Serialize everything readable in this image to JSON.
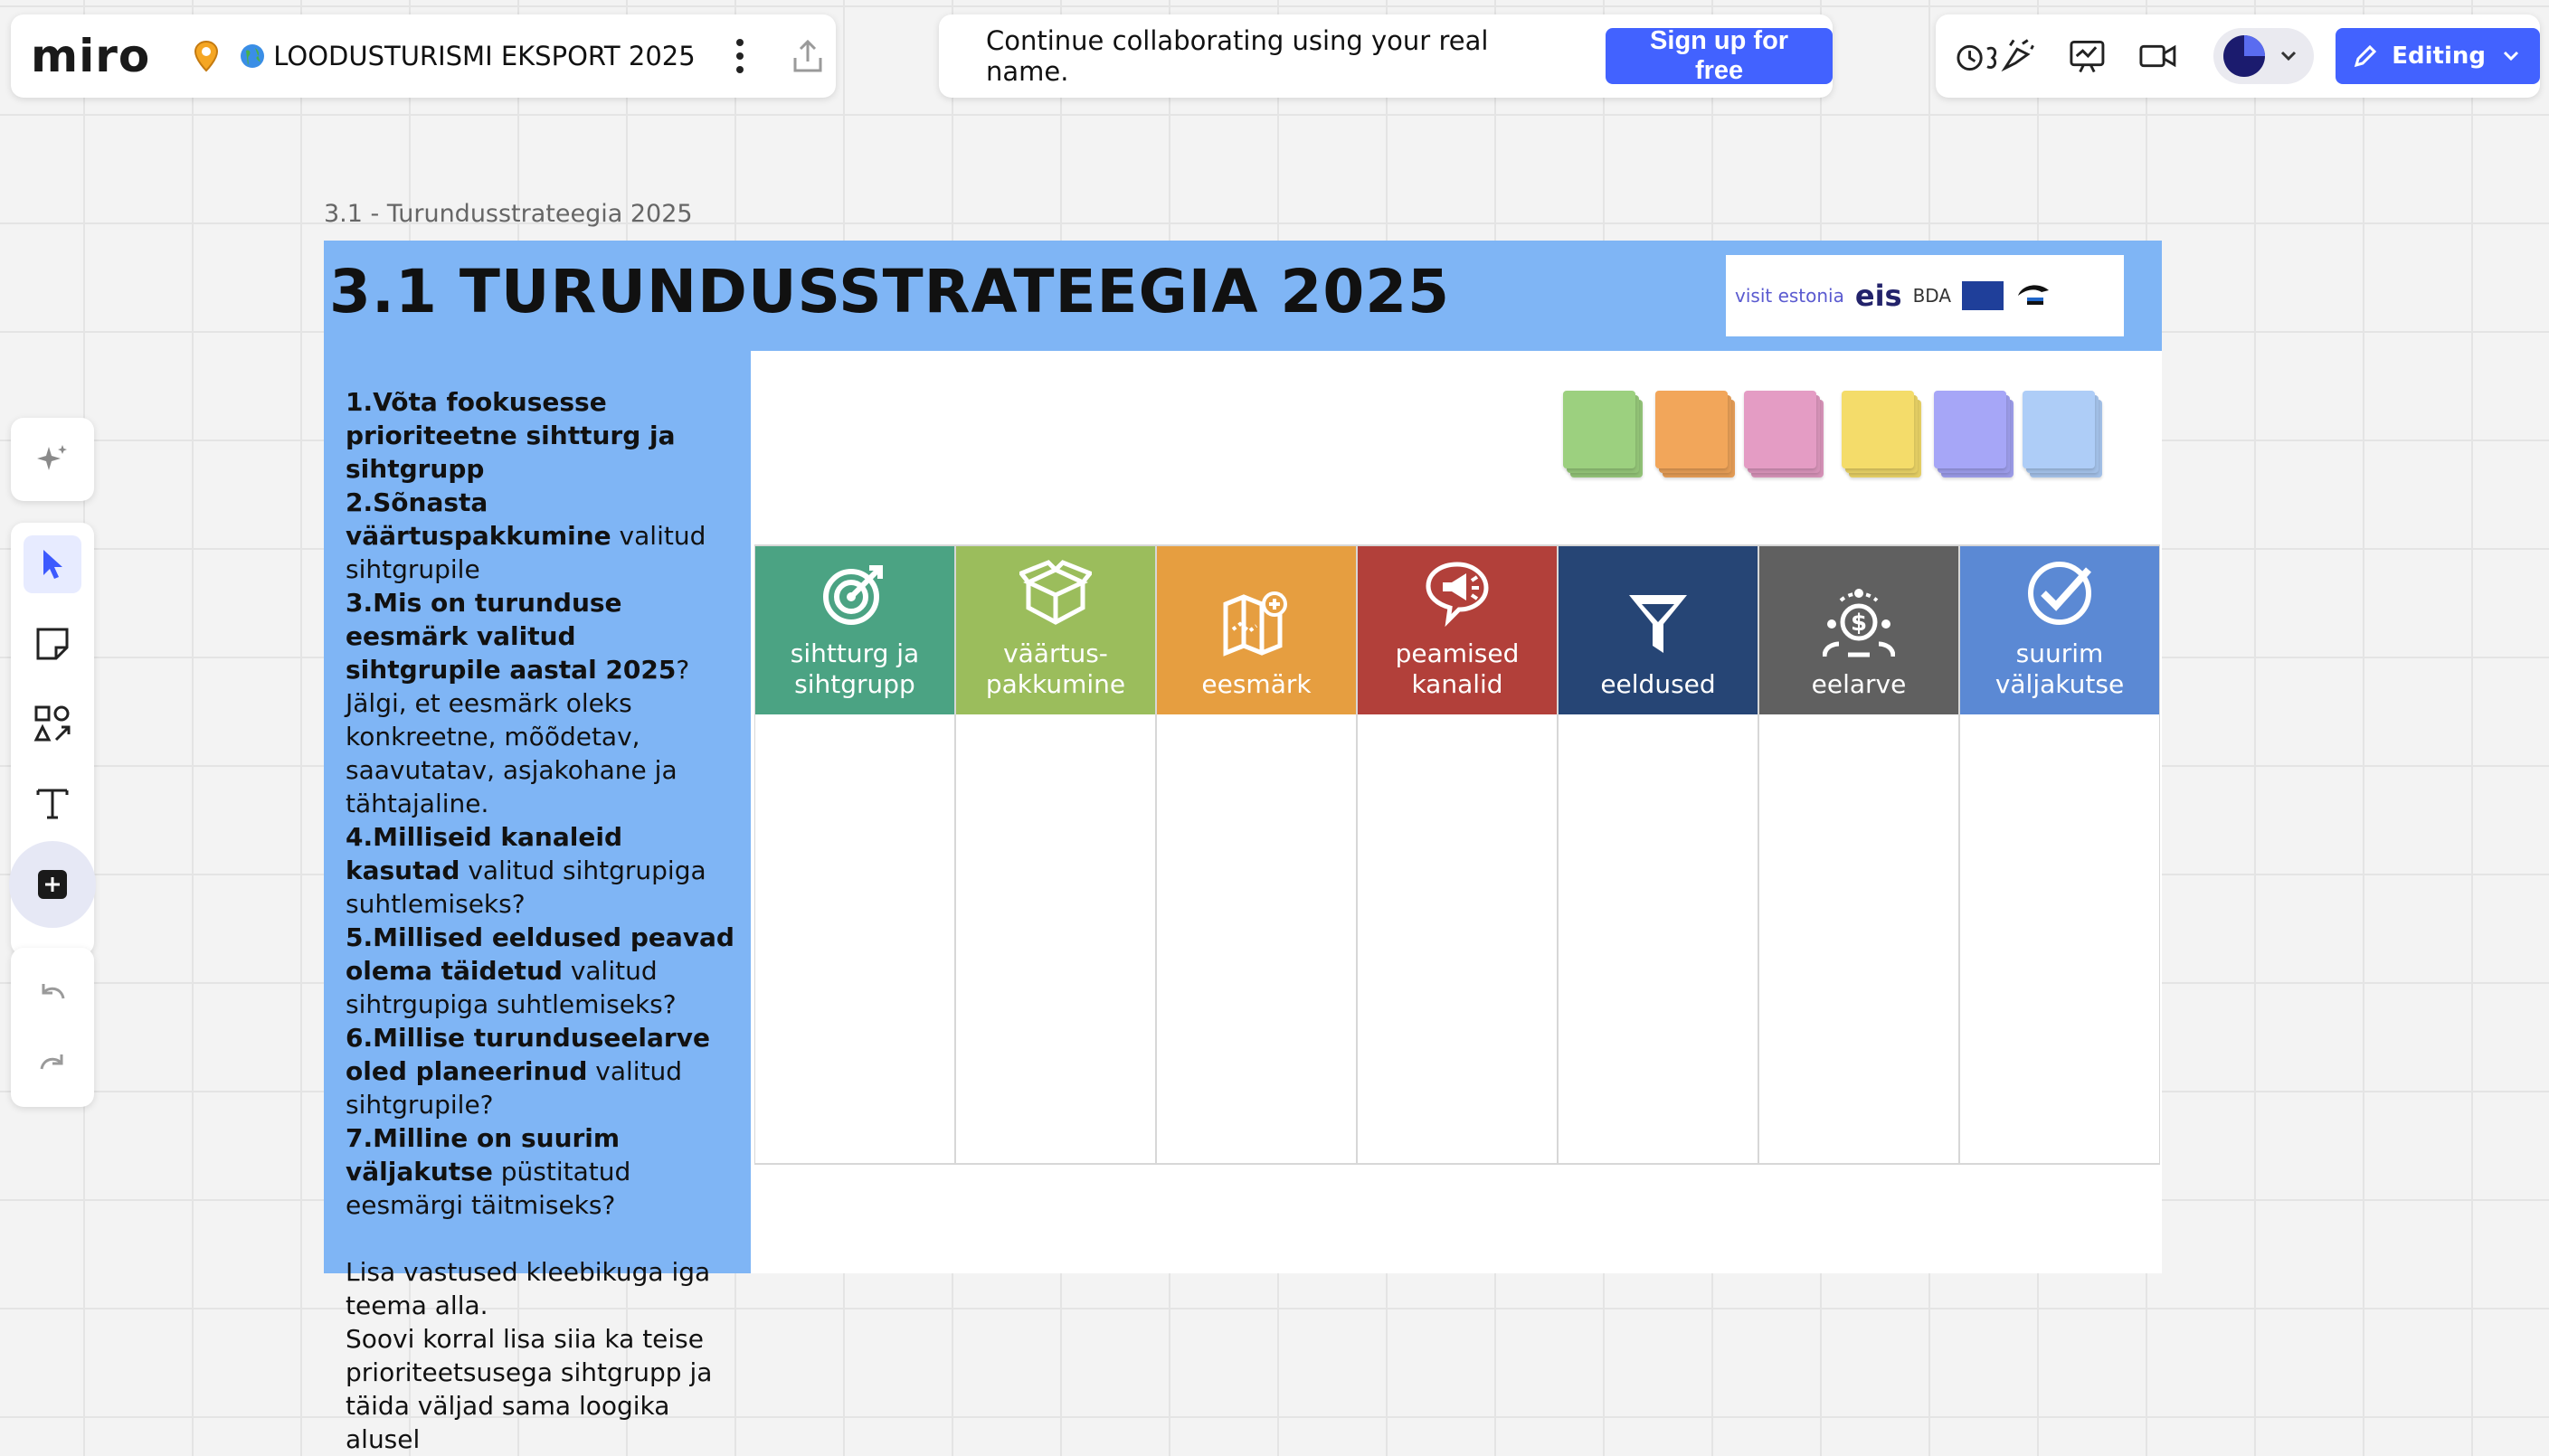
{
  "app": {
    "logo": "miro",
    "board_title": "LOODUSTURISMI EKSPORT 2025"
  },
  "banner": {
    "text": "Continue collaborating using your real name.",
    "signup_label": "Sign up for free"
  },
  "top_right": {
    "editing_label": "Editing"
  },
  "frame": {
    "label": "3.1 - Turundusstrateegia 2025",
    "title": "3.1 TURUNDUSSTRATEEGIA 2025",
    "logos": {
      "visit": "visit estonia",
      "eis": "eis",
      "bda": "BDA"
    }
  },
  "instructions": {
    "q1_bold": "1.Võta fookusesse prioriteetne sihtturg ja sihtgrupp",
    "q2_bold": "2.Sõnasta väärtuspakkumine",
    "q2_rest": " valitud sihtgrupile",
    "q3_bold": "3.Mis on turunduse eesmärk valitud sihtgrupile aastal 2025",
    "q3_rest": "?",
    "q3_note": "Jälgi, et eesmärk oleks konkreetne, mõõdetav, saavutatav, asjakohane ja tähtajaline.",
    "q4_bold": "4.Milliseid kanaleid kasutad",
    "q4_rest": " valitud sihtgrupiga suhtlemiseks?",
    "q5_bold": "5.Millised eeldused peavad olema täidetud",
    "q5_rest": " valitud sihtrgupiga suhtlemiseks?",
    "q6_bold": "6.Millise turunduseelarve oled planeerinud",
    "q6_rest": " valitud sihtgrupile?",
    "q7_bold": "7.Milline on suurim väljakutse",
    "q7_rest": " püstitatud eesmärgi täitmiseks?",
    "footer1": "Lisa vastused kleebikuga iga teema alla.",
    "footer2": "Soovi korral lisa siia ka teise prioriteetsusega sihtgrupp ja täida väljad sama loogika alusel"
  },
  "sticky_colors": [
    "#9cd07f",
    "#f2a65a",
    "#e49cc4",
    "#f4dc6a",
    "#a6a6f7",
    "#aecdf7"
  ],
  "columns": [
    {
      "l1": "sihtturg ja",
      "l2": "sihtgrupp",
      "color": "#4ba383",
      "icon": "target-icon"
    },
    {
      "l1": "väärtus-",
      "l2": "pakkumine",
      "color": "#9bbd5c",
      "icon": "box-icon"
    },
    {
      "l1": "",
      "l2": "eesmärk",
      "color": "#e69e40",
      "icon": "map-icon"
    },
    {
      "l1": "peamised",
      "l2": "kanalid",
      "color": "#b2403a",
      "icon": "megaphone-icon"
    },
    {
      "l1": "",
      "l2": "eeldused",
      "color": "#264575",
      "icon": "funnel-icon"
    },
    {
      "l1": "",
      "l2": "eelarve",
      "color": "#606060",
      "icon": "budget-icon"
    },
    {
      "l1": "suurim",
      "l2": "väljakutse",
      "color": "#5b89d4",
      "icon": "check-badge-icon"
    }
  ]
}
